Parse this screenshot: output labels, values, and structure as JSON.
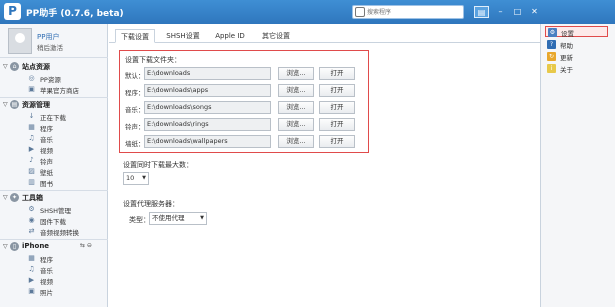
{
  "app": {
    "logo": "P",
    "title": "PP助手 (0.7.6, beta)"
  },
  "search": {
    "placeholder": "搜索程序"
  },
  "window": {
    "menu": "▤",
    "minimize": "–",
    "maximize": "□",
    "close": "✕"
  },
  "user": {
    "name": "PP用户",
    "logout": "稍后激活"
  },
  "sidebar": {
    "sections": [
      {
        "label": "站点资源",
        "icon": "home-icon",
        "items": [
          {
            "label": "PP资源",
            "icon": "pp-icon"
          },
          {
            "label": "苹果官方商店",
            "icon": "store-icon"
          }
        ]
      },
      {
        "label": "资源管理",
        "icon": "manage-icon",
        "items": [
          {
            "label": "正在下载",
            "icon": "download-icon"
          },
          {
            "label": "程序",
            "icon": "app-icon"
          },
          {
            "label": "音乐",
            "icon": "music-icon"
          },
          {
            "label": "视频",
            "icon": "video-icon"
          },
          {
            "label": "铃声",
            "icon": "ringtone-icon"
          },
          {
            "label": "壁纸",
            "icon": "wallpaper-icon"
          },
          {
            "label": "图书",
            "icon": "book-icon"
          }
        ]
      },
      {
        "label": "工具箱",
        "icon": "tools-icon",
        "items": [
          {
            "label": "SHSH管理",
            "icon": "shsh-icon"
          },
          {
            "label": "固件下载",
            "icon": "firmware-icon"
          },
          {
            "label": "音频视频转换",
            "icon": "convert-icon"
          }
        ]
      },
      {
        "label": "iPhone",
        "icon": "iphone-icon",
        "extra": "⇆ ⊖",
        "items": [
          {
            "label": "程序",
            "icon": "app-icon"
          },
          {
            "label": "音乐",
            "icon": "music-icon"
          },
          {
            "label": "视频",
            "icon": "video-icon"
          },
          {
            "label": "照片",
            "icon": "photo-icon"
          }
        ]
      }
    ]
  },
  "tabs": [
    {
      "label": "下载设置"
    },
    {
      "label": "SHSH设置"
    },
    {
      "label": "Apple ID"
    },
    {
      "label": "其它设置"
    }
  ],
  "download": {
    "title": "设置下载文件夹：",
    "rows": [
      {
        "label": "默认：",
        "path": "E:\\downloads"
      },
      {
        "label": "程序：",
        "path": "E:\\downloads\\apps"
      },
      {
        "label": "音乐：",
        "path": "E:\\downloads\\songs"
      },
      {
        "label": "铃声：",
        "path": "E:\\downloads\\rings"
      },
      {
        "label": "墙纸：",
        "path": "E:\\downloads\\wallpapers"
      }
    ],
    "browse_label": "浏览...",
    "open_label": "打开"
  },
  "max_downloads": {
    "label": "设置同时下载最大数：",
    "value": "10"
  },
  "proxy": {
    "label": "设置代理服务器：",
    "type_label": "类型：",
    "type_value": "不使用代理"
  },
  "menu": {
    "items": [
      {
        "label": "设置",
        "icon": "settings-icon",
        "color": "#4a7fc1",
        "glyph": "⚙"
      },
      {
        "label": "帮助",
        "icon": "help-icon",
        "color": "#2f6db3",
        "glyph": "?"
      },
      {
        "label": "更新",
        "icon": "update-icon",
        "color": "#e8a72c",
        "glyph": "↻"
      },
      {
        "label": "关于",
        "icon": "about-icon",
        "color": "#e8c94a",
        "glyph": "i"
      }
    ]
  },
  "colors": {
    "titlebar": "#3a86cc",
    "highlight": "#e04b4b"
  }
}
